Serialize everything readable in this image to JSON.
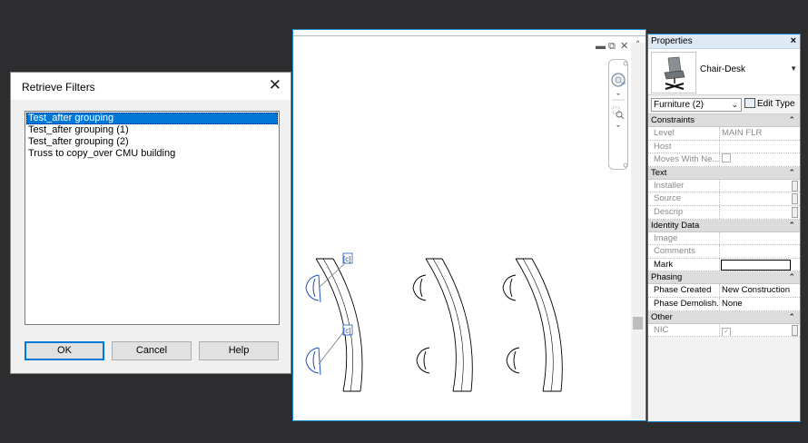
{
  "dialog": {
    "title": "Retrieve Filters",
    "close_glyph": "✕",
    "filters": [
      {
        "label": "Test_after grouping",
        "selected": true
      },
      {
        "label": "Test_after grouping (1)",
        "selected": false
      },
      {
        "label": "Test_after grouping (2)",
        "selected": false
      },
      {
        "label": "Truss to copy_over CMU building",
        "selected": false
      }
    ],
    "ok_label": "OK",
    "cancel_label": "Cancel",
    "help_label": "Help"
  },
  "canvas": {
    "minimize_glyph": "▬",
    "restore_glyph": "⧉",
    "close_glyph": "✕",
    "collapse_glyph": "^",
    "selection_tag_1": "[c]",
    "selection_tag_2": "[c]"
  },
  "properties": {
    "title": "Properties",
    "close_glyph": "×",
    "type_name": "Chair-Desk",
    "category_select": "Furniture (2)",
    "edit_type_label": "Edit Type",
    "groups": [
      {
        "name": "Constraints",
        "rows": [
          {
            "name": "Level",
            "value": "MAIN FLR",
            "disabled": true
          },
          {
            "name": "Host",
            "value": "",
            "disabled": true
          },
          {
            "name": "Moves With Ne...",
            "value": "",
            "disabled": true,
            "checkbox": true
          }
        ]
      },
      {
        "name": "Text",
        "rows": [
          {
            "name": "Installer",
            "value": "",
            "disabled": true,
            "button": true
          },
          {
            "name": "Source",
            "value": "",
            "disabled": true,
            "button": true
          },
          {
            "name": "Descrip",
            "value": "",
            "disabled": true,
            "button": true
          }
        ]
      },
      {
        "name": "Identity Data",
        "rows": [
          {
            "name": "Image",
            "value": "",
            "disabled": true
          },
          {
            "name": "Comments",
            "value": "",
            "disabled": true
          },
          {
            "name": "Mark",
            "value": "",
            "disabled": false,
            "editing": true
          }
        ]
      },
      {
        "name": "Phasing",
        "rows": [
          {
            "name": "Phase Created",
            "value": "New Construction",
            "disabled": false
          },
          {
            "name": "Phase Demolish...",
            "value": "None",
            "disabled": false
          }
        ]
      },
      {
        "name": "Other",
        "rows": [
          {
            "name": "NIC",
            "value": "",
            "disabled": true,
            "checkbox": true,
            "checked": true,
            "button": true
          }
        ]
      }
    ]
  }
}
